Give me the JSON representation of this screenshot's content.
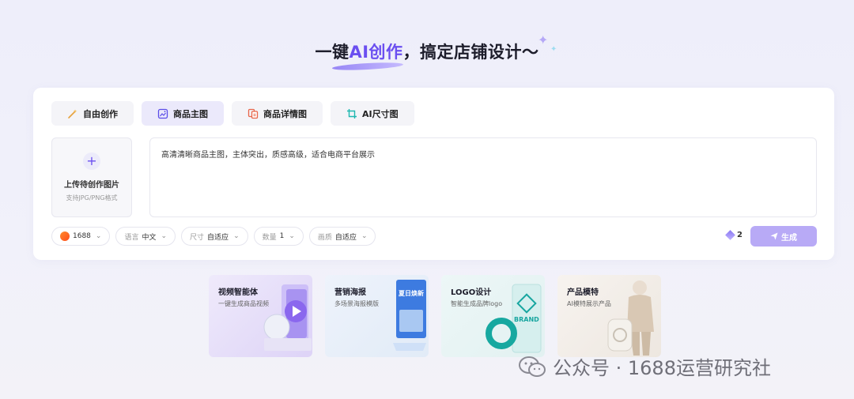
{
  "headline": {
    "prefix": "一键",
    "ai": "AI创作",
    "suffix": "，搞定店铺设计～"
  },
  "tabs": [
    {
      "label": "自由创作",
      "icon": "magic-wand-icon",
      "active": false
    },
    {
      "label": "商品主图",
      "icon": "image-icon",
      "active": true
    },
    {
      "label": "商品详情图",
      "icon": "detail-image-icon",
      "active": false
    },
    {
      "label": "AI尺寸图",
      "icon": "crop-icon",
      "active": false
    }
  ],
  "upload": {
    "title": "上传待创作图片",
    "subtitle": "支持JPG/PNG格式"
  },
  "prompt": {
    "value": "高清清晰商品主图，主体突出，质感高级，适合电商平台展示"
  },
  "controls": {
    "platform": "1688",
    "language_key": "语言",
    "language_value": "中文",
    "size_key": "尺寸",
    "size_value": "自适应",
    "count_key": "数量",
    "count_value": "1",
    "quality_key": "画质",
    "quality_value": "自适应"
  },
  "credits": "2",
  "generate_label": "生成",
  "features": [
    {
      "title": "视频智能体",
      "subtitle": "一键生成商品视频"
    },
    {
      "title": "营销海报",
      "subtitle": "多场景海报模版"
    },
    {
      "title": "LOGO设计",
      "subtitle": "智能生成品牌logo"
    },
    {
      "title": "产品模特",
      "subtitle": "AI模特展示产品"
    }
  ],
  "poster_art_text": "夏日焕新",
  "logo_art_text": "BRAND",
  "watermark": "公众号 · 1688运营研究社",
  "colors": {
    "accent": "#6b4ff0",
    "generate_bg": "#b8aaf6",
    "active_tab_bg": "#ebe9fb"
  }
}
